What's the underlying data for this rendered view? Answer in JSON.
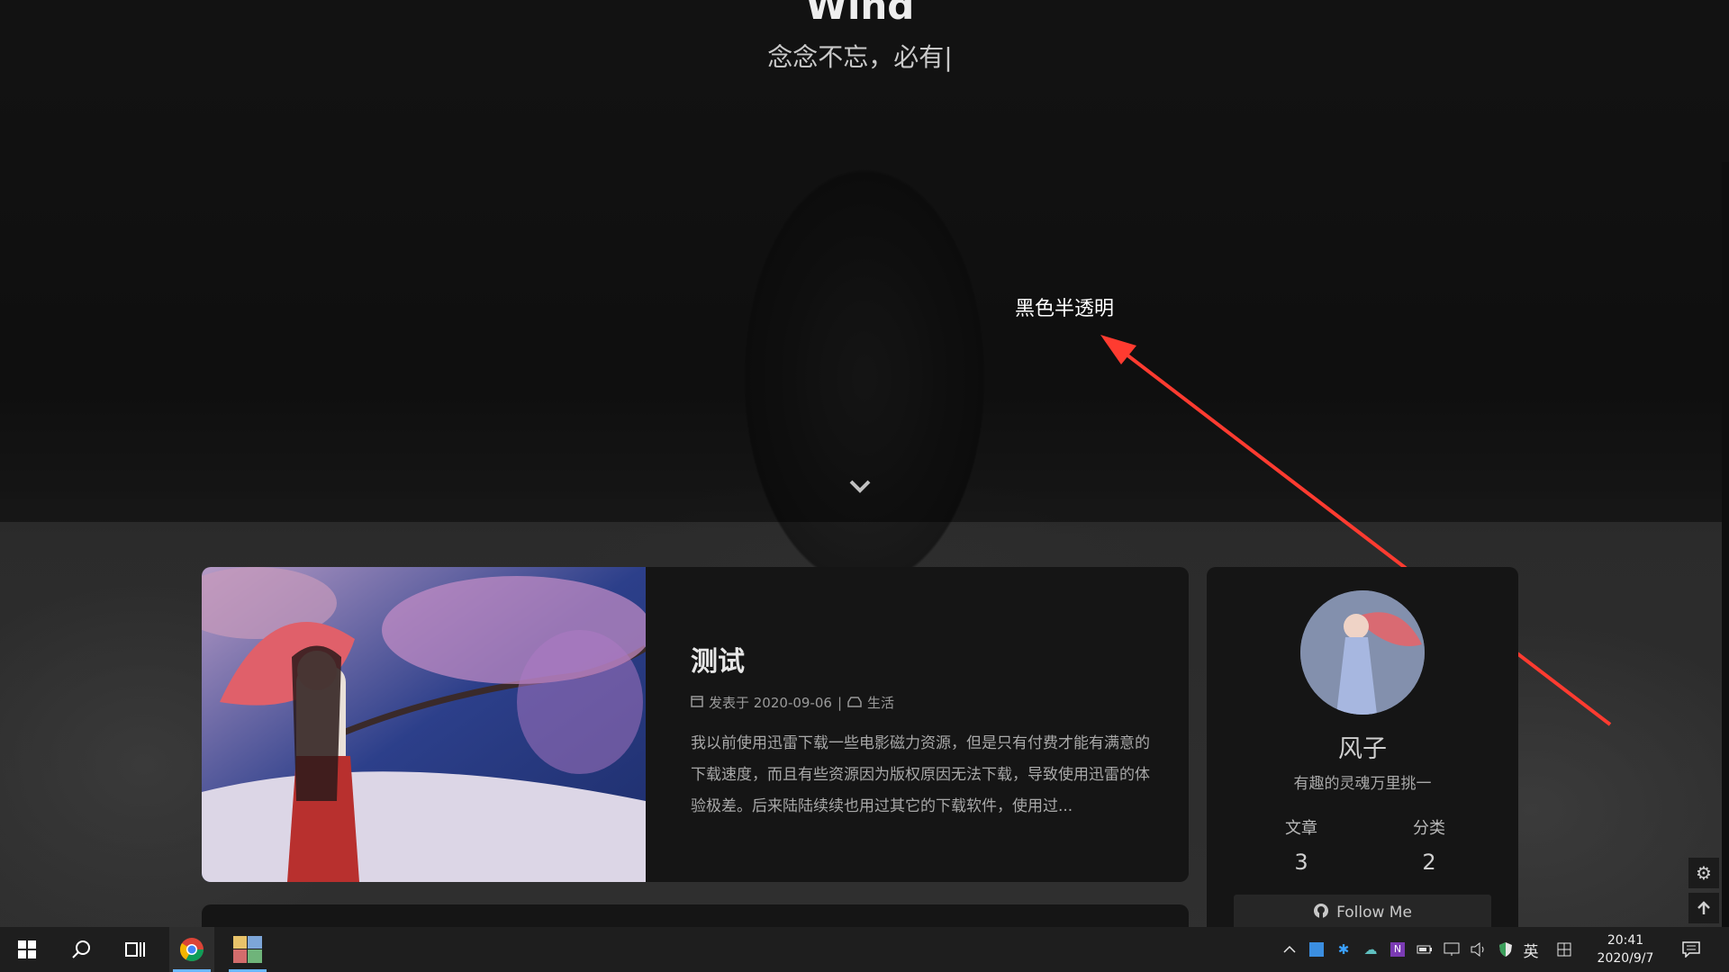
{
  "hero": {
    "title": "Wind",
    "subtitle": "念念不忘，必有|"
  },
  "annotation": {
    "text": "黑色半透明",
    "color": "#ff3b30"
  },
  "post": {
    "title": "测试",
    "meta_date": "发表于 2020-09-06",
    "meta_separator": "|",
    "meta_category": "生活",
    "excerpt": "我以前使用迅雷下载一些电影磁力资源，但是只有付费才能有满意的下载速度，而且有些资源因为版权原因无法下载，导致使用迅雷的体验极差。后来陆陆续续也用过其它的下载软件，使用过..."
  },
  "profile": {
    "name": "风子",
    "motto": "有趣的灵魂万里挑一",
    "stats": [
      {
        "label": "文章",
        "value": "3"
      },
      {
        "label": "分类",
        "value": "2"
      }
    ],
    "follow_label": "Follow Me"
  },
  "taskbar": {
    "time": "20:41",
    "date": "2020/9/7",
    "ime_lang": "英",
    "accent": "#6ab7ff"
  }
}
